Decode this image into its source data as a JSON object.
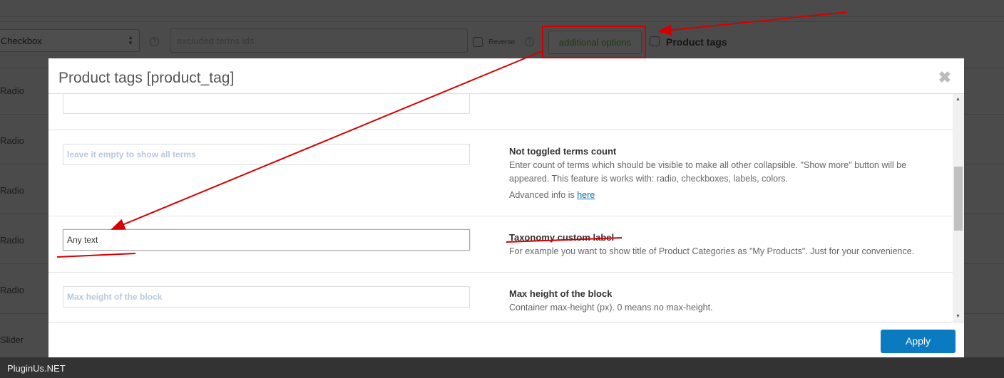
{
  "background": {
    "type_select": "Checkbox",
    "excluded_placeholder": "excluded terms ids",
    "reverse_label": "Reverse",
    "help": "?",
    "additional_options": "additional options",
    "product_tags_label": "Product tags",
    "rows": [
      "Radio",
      "Radio",
      "Radio",
      "Radio",
      "Radio",
      "Slider"
    ]
  },
  "modal": {
    "title": "Product tags [product_tag]",
    "close": "✖",
    "fields": [
      {
        "placeholder": "leave it empty to show all terms",
        "value": "",
        "title": "Not toggled terms count",
        "description": "Enter count of terms which should be visible to make all other collapsible. \"Show more\" button will be appeared. This feature is works with: radio, checkboxes, labels, colors.",
        "info_prefix": "Advanced info is ",
        "info_link": "here"
      },
      {
        "placeholder": "",
        "value": "Any  text",
        "title": "Taxonomy custom label",
        "description": "For example you want to show title of Product Categories as \"My Products\". Just for your convenience."
      },
      {
        "placeholder": "Max height of  the block",
        "value": "",
        "title": "Max height of the block",
        "description": "Container max-height (px). 0 means no max-height."
      }
    ],
    "apply": "Apply"
  },
  "footer": {
    "brand": "PluginUs.NET"
  },
  "colors": {
    "annotation": "#d40000",
    "apply": "#0a7bc1"
  }
}
